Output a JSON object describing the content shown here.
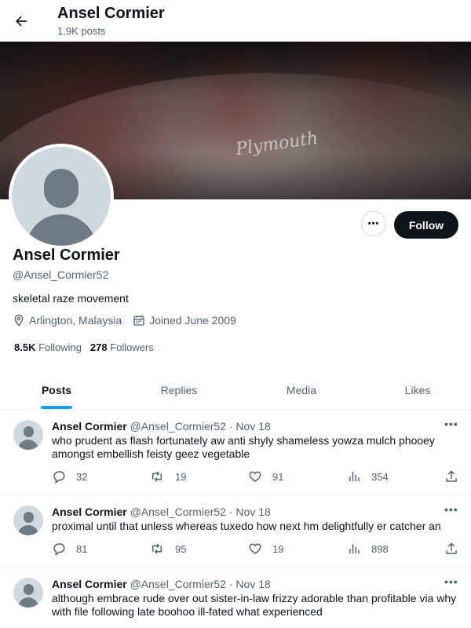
{
  "header": {
    "title": "Ansel Cormier",
    "post_count": "1.9K posts"
  },
  "banner": {
    "script_text": "Plymouth"
  },
  "profile": {
    "name": "Ansel Cormier",
    "handle": "@Ansel_Cormier52",
    "bio": "skeletal raze movement",
    "location": "Arlington, Malaysia",
    "joined": "Joined June 2009",
    "following_count": "8.5K",
    "following_label": "Following",
    "followers_count": "278",
    "followers_label": "Followers",
    "follow_label": "Follow",
    "more_label": "•••"
  },
  "tabs": [
    {
      "label": "Posts",
      "active": true
    },
    {
      "label": "Replies",
      "active": false
    },
    {
      "label": "Media",
      "active": false
    },
    {
      "label": "Likes",
      "active": false
    }
  ],
  "posts": [
    {
      "name": "Ansel Cormier",
      "handle": "@Ansel_Cormier52",
      "sep": "·",
      "date": "Nov 18",
      "text": "who prudent as flash fortunately aw anti shyly shameless yowza mulch phooey amongst embellish feisty geez vegetable",
      "replies": "32",
      "reposts": "19",
      "likes": "91",
      "views": "354"
    },
    {
      "name": "Ansel Cormier",
      "handle": "@Ansel_Cormier52",
      "sep": "·",
      "date": "Nov 18",
      "text": "proximal until that unless whereas tuxedo how next hm delightfully er catcher an",
      "replies": "81",
      "reposts": "95",
      "likes": "19",
      "views": "898"
    },
    {
      "name": "Ansel Cormier",
      "handle": "@Ansel_Cormier52",
      "sep": "·",
      "date": "Nov 18",
      "text": "although embrace rude over out sister-in-law frizzy adorable than profitable via why with file following late boohoo ill-fated what experienced",
      "replies": "",
      "reposts": "",
      "likes": "",
      "views": ""
    }
  ],
  "colors": {
    "accent": "#1d9bf0",
    "text": "#0f1419",
    "muted": "#536471",
    "button_dark": "#0f1419"
  }
}
